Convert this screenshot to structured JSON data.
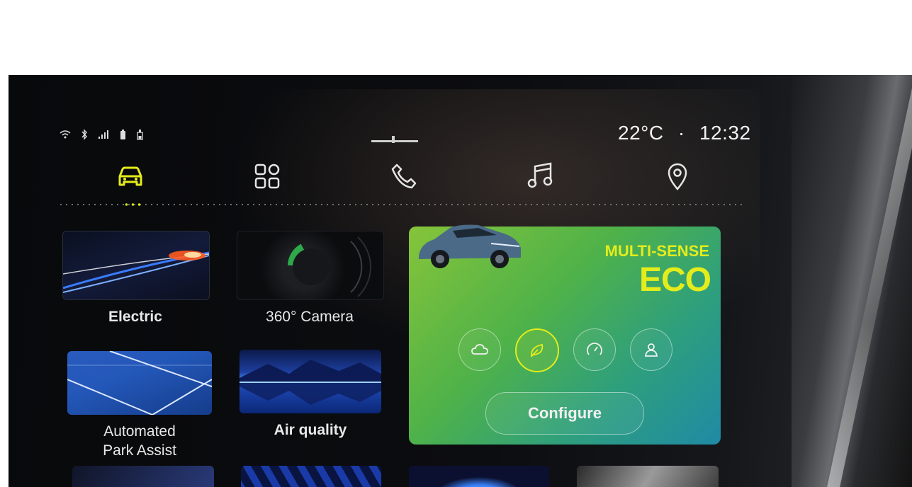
{
  "status": {
    "icons": [
      "wifi-icon",
      "bluetooth-icon",
      "signal-icon",
      "battery-icon",
      "charging-icon"
    ],
    "temperature": "22°C",
    "separator": "·",
    "time": "12:32"
  },
  "nav": {
    "items": [
      "vehicle-icon",
      "apps-icon",
      "phone-icon",
      "music-icon",
      "navigation-icon"
    ],
    "active": "vehicle-icon"
  },
  "tiles": [
    {
      "label": "Electric"
    },
    {
      "label": "360° Camera"
    },
    {
      "label": "Automated Park Assist"
    },
    {
      "label": "Air quality"
    }
  ],
  "multisense": {
    "title": "MULTI-SENSE",
    "mode": "ECO",
    "modes": [
      "comfort-icon",
      "eco-icon",
      "sport-icon",
      "personal-icon"
    ],
    "active_mode": "eco-icon",
    "configure_label": "Configure"
  },
  "colors": {
    "accent": "#e4ec1c",
    "panel_green": "#4fb249",
    "panel_teal": "#1f8aa5"
  }
}
